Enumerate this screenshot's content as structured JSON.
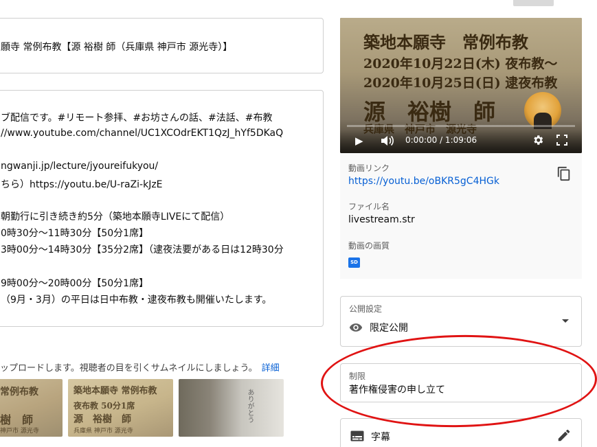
{
  "title_field": {
    "value": "願寺 常例布教【源 裕樹 師（兵庫県 神戸市 源光寺）】"
  },
  "description_field": {
    "lines": [
      "ブ配信です。#リモート参拝、#お坊さんの話、#法話、#布教",
      "//www.youtube.com/channel/UC1XCOdrEKT1QzJ_hYf5DKaQ",
      "",
      "ngwanji.jp/lecture/jyoureifukyou/",
      "ちら）https://youtu.be/U-raZi-kJzE",
      "",
      "朝勤行に引き続き約5分（築地本願寺LIVEにて配信）",
      "0時30分～11時30分【50分1席】",
      "3時00分～14時30分【35分2席】（逮夜法要がある日は12時30分",
      "",
      "9時00分～20時00分【50分1席】",
      "（9月・3月）の平日は日中布教・逮夜布教も開催いたします。"
    ]
  },
  "thumbnails": {
    "caption": "ップロードします。視聴者の目を引くサムネイルにしましょう。",
    "link_label": "詳細",
    "t1": [
      "常例布教",
      "樹　師",
      "神戸市 源光寺"
    ],
    "t2": [
      "築地本願寺 常例布教",
      "夜布教 50分1席",
      "源　裕樹　師",
      "兵庫県 神戸市 源光寺"
    ],
    "t3": [
      "ありがとう"
    ]
  },
  "player": {
    "lines": [
      "築地本願寺　常例布教",
      "2020年10月22日(木) 夜布教〜",
      "2020年10月25日(日) 逮夜布教",
      "源　裕樹　師",
      "兵庫県　神戸市　源光寺"
    ],
    "time": "0:00:00 / 1:09:06"
  },
  "video_info": {
    "link_label": "動画リンク",
    "link_value": "https://youtu.be/oBKR5gC4HGk",
    "filename_label": "ファイル名",
    "filename_value": "livestream.str",
    "quality_label": "動画の画質",
    "quality_badge": "SD"
  },
  "visibility": {
    "label": "公開設定",
    "value": "限定公開"
  },
  "restrictions": {
    "label": "制限",
    "value": "著作権侵害の申し立て"
  },
  "subtitles": {
    "label": "字幕"
  }
}
